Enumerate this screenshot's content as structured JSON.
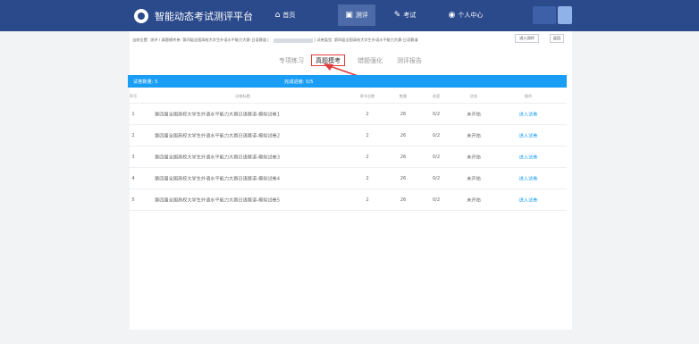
{
  "app": {
    "title": "智能动态考试测评平台",
    "logo_icon": "logo-icon"
  },
  "nav": {
    "home": {
      "icon": "home-icon",
      "label": "首页"
    },
    "test": {
      "icon": "test-icon",
      "label": "测评"
    },
    "exam": {
      "icon": "exam-icon",
      "label": "考试"
    },
    "user": {
      "icon": "user-icon",
      "label": "个人中心"
    }
  },
  "breadcrumb": {
    "prefix": "当前位置:",
    "path": "测评 / 真题模考卷: 第四届全国高校大学生外语水平能力大赛-日语赛道 |",
    "type_label": "| 试卷类型: 第四届全国高校大学生外语水平能力大赛-日语赛道"
  },
  "actions": {
    "enter_exam": "进入测评",
    "back": "返回"
  },
  "tabs": [
    {
      "label": "专项练习"
    },
    {
      "label": "真题模考"
    },
    {
      "label": "错题强化"
    },
    {
      "label": "测评报告"
    }
  ],
  "summary": {
    "count_text": "试卷数量: 5",
    "progress_text": "完成进度: 0/5"
  },
  "table": {
    "headers": {
      "index": "序号",
      "name": "试卷标题",
      "parts": "章节总数",
      "qty": "数量",
      "progress": "进度",
      "status": "状态",
      "op": "操作"
    },
    "rows": [
      {
        "index": "1",
        "name": "第四届全国高校大学生外语水平能力大赛日语赛道-模拟试卷1",
        "parts": "2",
        "qty": "26",
        "progress": "0/2",
        "status": "未开始",
        "op": "进入试卷"
      },
      {
        "index": "2",
        "name": "第四届全国高校大学生外语水平能力大赛日语赛道-模拟试卷2",
        "parts": "2",
        "qty": "26",
        "progress": "0/2",
        "status": "未开始",
        "op": "进入试卷"
      },
      {
        "index": "3",
        "name": "第四届全国高校大学生外语水平能力大赛日语赛道-模拟试卷3",
        "parts": "2",
        "qty": "26",
        "progress": "0/2",
        "status": "未开始",
        "op": "进入试卷"
      },
      {
        "index": "4",
        "name": "第四届全国高校大学生外语水平能力大赛日语赛道-模拟试卷4",
        "parts": "2",
        "qty": "26",
        "progress": "0/2",
        "status": "未开始",
        "op": "进入试卷"
      },
      {
        "index": "5",
        "name": "第四届全国高校大学生外语水平能力大赛日语赛道-模拟试卷5",
        "parts": "2",
        "qty": "26",
        "progress": "0/2",
        "status": "未开始",
        "op": "进入试卷"
      }
    ]
  },
  "colors": {
    "topbar": "#2b4a8b",
    "accent": "#1a9ef5",
    "highlight": "#e03b3b"
  }
}
